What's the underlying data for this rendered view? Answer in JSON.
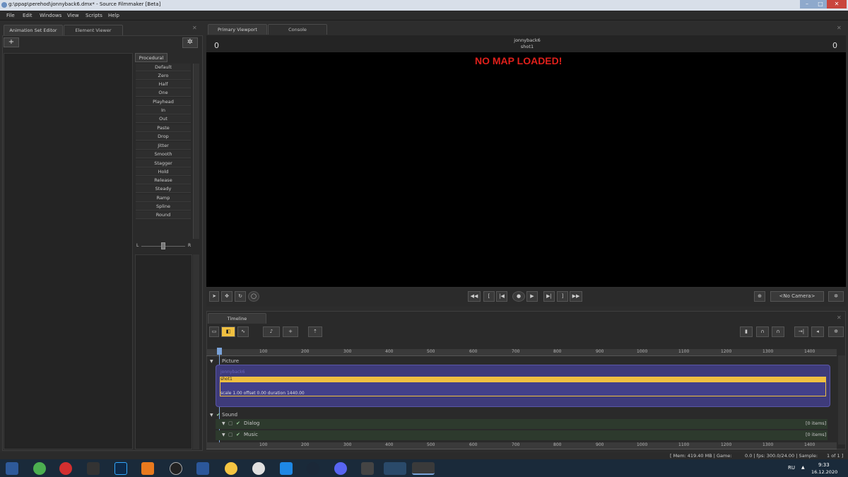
{
  "window": {
    "title": "g:\\ppap\\perehod\\jonnyback6.dmx* - Source Filmmaker [Beta]",
    "min": "–",
    "max": "□",
    "close": "✕"
  },
  "menu": [
    "File",
    "Edit",
    "Windows",
    "View",
    "Scripts",
    "Help"
  ],
  "left_tabs": [
    "Animation Set Editor",
    "Element Viewer"
  ],
  "procedural": {
    "header": "Procedural",
    "items": [
      "Default",
      "Zero",
      "Half",
      "One",
      "Playhead",
      "In",
      "Out",
      "Paste",
      "Drop",
      "Jitter",
      "Smooth",
      "Stagger",
      "Hold",
      "Release",
      "Steady",
      "Ramp",
      "Spline",
      "Round"
    ],
    "balance_left": "L",
    "balance_right": "R"
  },
  "viewport_tabs": [
    "Primary Viewport",
    "Console"
  ],
  "viewport": {
    "frame_left": "0",
    "frame_right": "0",
    "session": "jonnyback6",
    "shot": "shot1",
    "warning": "NO MAP LOADED!",
    "camera": "<No Camera>"
  },
  "timeline": {
    "tab": "Timeline",
    "ruler": [
      "100",
      "200",
      "300",
      "400",
      "500",
      "600",
      "700",
      "800",
      "900",
      "1000",
      "1100",
      "1200",
      "1300",
      "1400"
    ],
    "picture_label": "Picture",
    "clip_name": "jonnyback6",
    "shot_name": "shot1",
    "shot_info": "scale 1.00 offset 0.00 duration 1440.00",
    "sound_label": "Sound",
    "tracks": [
      {
        "name": "Dialog",
        "count": "[0 items]"
      },
      {
        "name": "Music",
        "count": "[0 items]"
      }
    ]
  },
  "status": {
    "mem": "[ Mem:   419.40 MB | Game:",
    "fps": "0.0 | fps:  300.0/24.00 | Sample:",
    "sample": "1 of 1 ]"
  },
  "taskbar": {
    "lang": "RU",
    "time": "9:33",
    "date": "16.12.2020"
  },
  "colors": {
    "shot_accent": "#f0c040",
    "warning": "#e0201b",
    "clip_bg": "#3e3b7a"
  }
}
